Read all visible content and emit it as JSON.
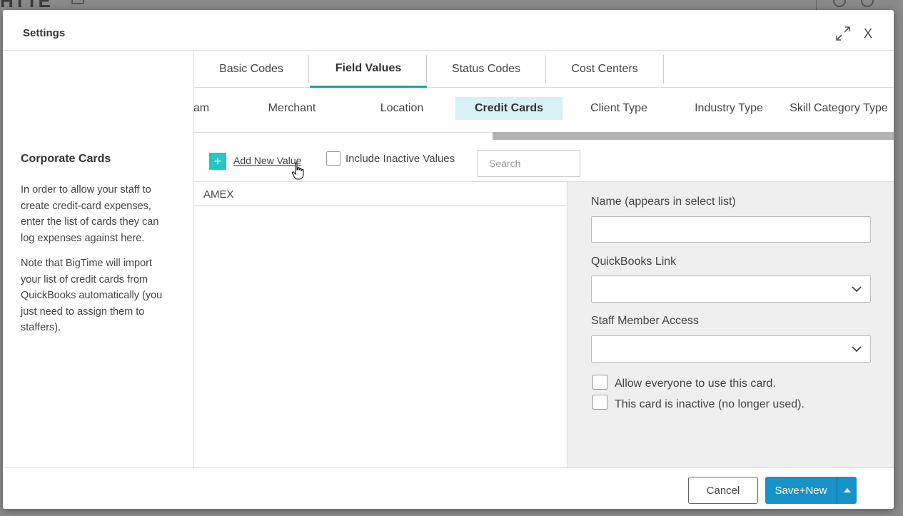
{
  "background": {
    "logo_text": "HTTE"
  },
  "modal": {
    "title": "Settings",
    "close_label": "X"
  },
  "sidebar": {
    "heading": "Corporate Cards",
    "paragraph1": "In order to allow your staff to create credit-card expenses, enter the list of cards they can log expenses against here.",
    "paragraph2": "Note that BigTime will import your list of credit cards from QuickBooks automatically (you just need to assign them to staffers)."
  },
  "tabs": [
    {
      "label": "Basic Codes",
      "active": false
    },
    {
      "label": "Field Values",
      "active": true
    },
    {
      "label": "Status Codes",
      "active": false
    },
    {
      "label": "Cost Centers",
      "active": false
    }
  ],
  "subtabs": [
    {
      "label": "am",
      "active": false
    },
    {
      "label": "Merchant",
      "active": false
    },
    {
      "label": "Location",
      "active": false
    },
    {
      "label": "Credit Cards",
      "active": true
    },
    {
      "label": "Client Type",
      "active": false
    },
    {
      "label": "Industry Type",
      "active": false
    },
    {
      "label": "Skill Category Type",
      "active": false
    }
  ],
  "toolbar": {
    "add_icon": "+",
    "add_label": "Add New Value",
    "include_inactive_label": "Include Inactive Values",
    "include_inactive_checked": false,
    "search_placeholder": "Search",
    "search_value": ""
  },
  "list": {
    "items": [
      "AMEX"
    ]
  },
  "form": {
    "name_label": "Name (appears in select list)",
    "name_value": "",
    "quickbooks_label": "QuickBooks Link",
    "quickbooks_value": "",
    "staff_label": "Staff Member Access",
    "staff_value": "",
    "allow_everyone_label": "Allow everyone to use this card.",
    "allow_everyone_checked": false,
    "inactive_label": "This card is inactive (no longer used).",
    "inactive_checked": false
  },
  "footer": {
    "cancel_label": "Cancel",
    "save_label": "Save+New"
  },
  "colors": {
    "accent_teal": "#24c6c6",
    "active_subtab_bg": "#d7f1f4",
    "tab_underline": "#1aa5a5",
    "primary_button": "#1793c9"
  }
}
